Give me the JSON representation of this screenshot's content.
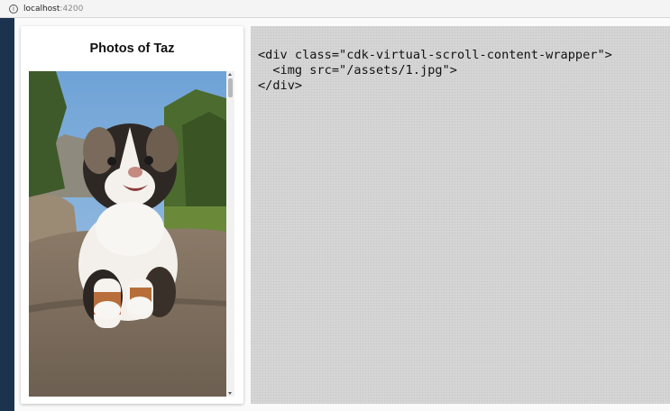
{
  "browser": {
    "url_host": "localhost",
    "url_port": ":4200",
    "info_icon": "info-icon"
  },
  "card": {
    "title": "Photos of Taz",
    "photo_icon": "puppy-photo"
  },
  "code": {
    "lines": [
      "<div class=\"cdk-virtual-scroll-content-wrapper\">",
      "  <img src=\"/assets/1.jpg\">",
      "</div>"
    ]
  },
  "colors": {
    "code_panel_bg": "#d5d5d5",
    "page_bg": "#fafafa",
    "window_frame": "#22354f"
  }
}
